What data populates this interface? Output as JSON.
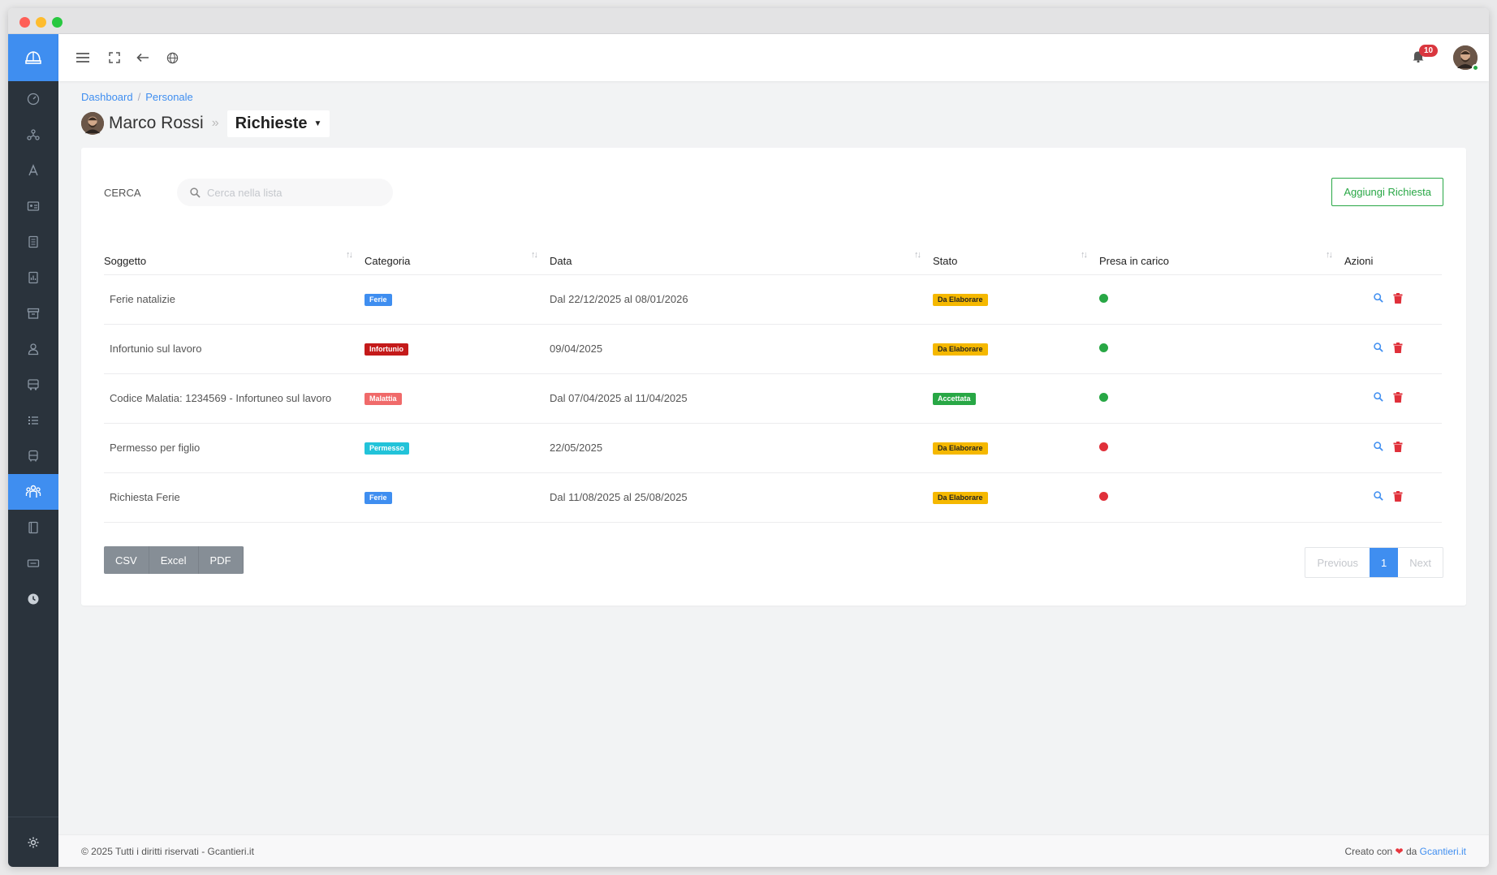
{
  "topbar": {
    "notifications_count": "10"
  },
  "breadcrumb": {
    "item1": "Dashboard",
    "item2": "Personale"
  },
  "header": {
    "person_name": "Marco Rossi",
    "section": "Richieste"
  },
  "search": {
    "label": "CERCA",
    "placeholder": "Cerca nella lista"
  },
  "actions": {
    "add_label": "Aggiungi Richiesta"
  },
  "table": {
    "headers": [
      "Soggetto",
      "Categoria",
      "Data",
      "Stato",
      "Presa in carico",
      "Azioni"
    ],
    "rows": [
      {
        "subject": "Ferie natalizie",
        "category": "Ferie",
        "category_color": "#3f8ef0",
        "date": "Dal 22/12/2025 al 08/01/2026",
        "status": "Da Elaborare",
        "status_color": "#f5b800",
        "taken_color": "#28a745"
      },
      {
        "subject": "Infortunio sul lavoro",
        "category": "Infortunio",
        "category_color": "#c41a1a",
        "date": "09/04/2025",
        "status": "Da Elaborare",
        "status_color": "#f5b800",
        "taken_color": "#28a745"
      },
      {
        "subject": "Codice Malatia: 1234569 - Infortuneo sul lavoro",
        "category": "Malattia",
        "category_color": "#f06a6a",
        "date": "Dal 07/04/2025 al 11/04/2025",
        "status": "Accettata",
        "status_color": "#28a745",
        "taken_color": "#28a745"
      },
      {
        "subject": "Permesso per figlio",
        "category": "Permesso",
        "category_color": "#22c3d9",
        "date": "22/05/2025",
        "status": "Da Elaborare",
        "status_color": "#f5b800",
        "taken_color": "#e0303a"
      },
      {
        "subject": "Richiesta Ferie",
        "category": "Ferie",
        "category_color": "#3f8ef0",
        "date": "Dal 11/08/2025 al 25/08/2025",
        "status": "Da Elaborare",
        "status_color": "#f5b800",
        "taken_color": "#e0303a"
      }
    ]
  },
  "export": {
    "csv": "CSV",
    "excel": "Excel",
    "pdf": "PDF"
  },
  "pagination": {
    "previous": "Previous",
    "current": "1",
    "next": "Next"
  },
  "footer": {
    "left": "© 2025 Tutti i diritti riservati - Gcantieri.it",
    "created_with": "Creato con",
    "by": "da",
    "link": "Gcantieri.it"
  },
  "colors": {
    "accent": "#3f8ef0",
    "sidebar": "#2a333c",
    "success": "#28a745",
    "danger": "#e0303a"
  }
}
